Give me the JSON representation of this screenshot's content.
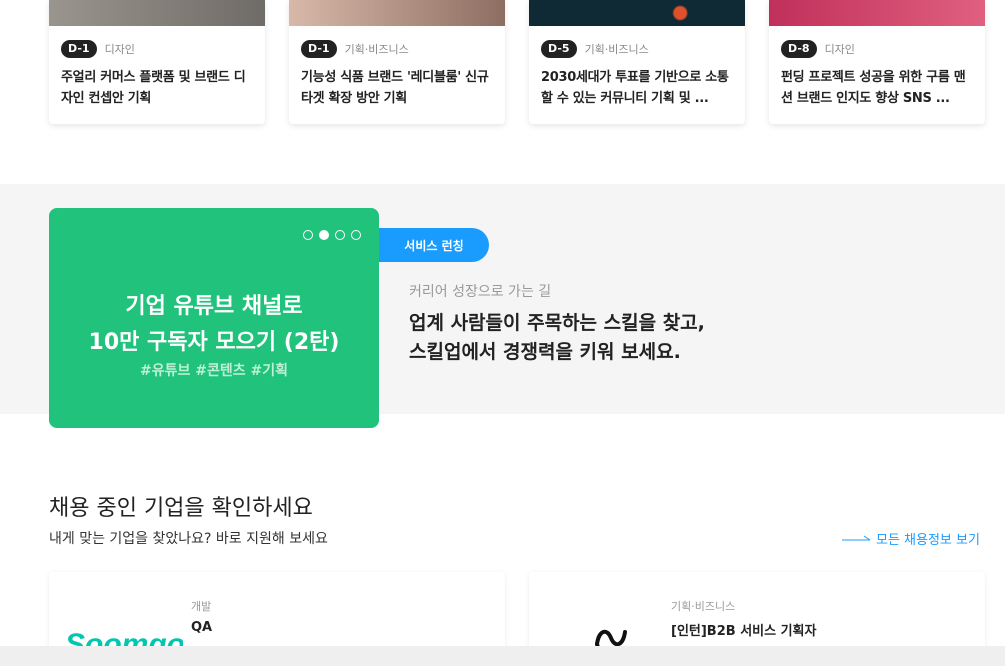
{
  "cards": [
    {
      "dday": "D-1",
      "category": "디자인",
      "title": "주얼리 커머스 플랫폼 및 브랜드 디자인 컨셉안 기획",
      "thumb_color": "#8a8680"
    },
    {
      "dday": "D-1",
      "category": "기획·비즈니스",
      "title": "기능성 식품 브랜드 '레디블룸' 신규 타겟 확장 방안 기획",
      "thumb_color": "#b89a8a"
    },
    {
      "dday": "D-5",
      "category": "기획·비즈니스",
      "title": "2030세대가 투표를 기반으로 소통할 수 있는 커뮤니티 기획 및 ...",
      "thumb_color": "#0f2a34"
    },
    {
      "dday": "D-8",
      "category": "디자인",
      "title": "펀딩 프로젝트 성공을 위한 구름 맨션 브랜드 인지도 향상 SNS ...",
      "thumb_color": "#c0305a"
    }
  ],
  "promo": {
    "line1": "기업 유튜브 채널로",
    "line2": "10만 구독자 모으기 (2탄)",
    "tags": "#유튜브 #콘텐츠 #기획",
    "active_slide": 2,
    "slide_count": 4,
    "color": "#20c27c"
  },
  "band": {
    "pill": "서비스 런칭",
    "subtitle": "커리어 성장으로 가는 길",
    "headline1": "업계 사람들이 주목하는 스킬을 찾고,",
    "headline2": "스킬업에서 경쟁력을 키워 보세요."
  },
  "hiring": {
    "title": "채용 중인 기업을 확인하세요",
    "subtitle": "내게 맞는 기업을 찾았나요? 바로 지원해 보세요",
    "see_all": "모든 채용정보 보기",
    "jobs": [
      {
        "category": "개발",
        "title": "QA",
        "logo_text": "Soomgo",
        "logo_color": "#00c7ae"
      },
      {
        "category": "기획·비즈니스",
        "title": "[인턴]B2B 서비스 기획자",
        "logo_icon": "wave-logo-icon"
      }
    ]
  },
  "colors": {
    "accent": "#1a9cff",
    "promo_green": "#20c27c"
  }
}
